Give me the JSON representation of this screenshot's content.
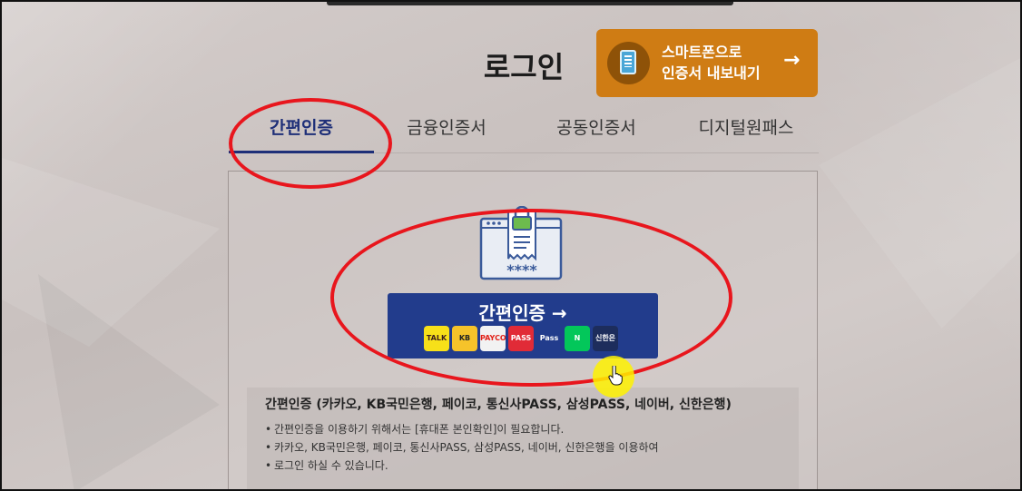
{
  "page": {
    "title": "로그인"
  },
  "export_button": {
    "line1": "스마트폰으로",
    "line2": "인증서 내보내기",
    "arrow": "→",
    "icon": "smartphone-icon"
  },
  "tabs": [
    {
      "label": "간편인증",
      "active": true
    },
    {
      "label": "금융인증서",
      "active": false
    },
    {
      "label": "공동인증서",
      "active": false
    },
    {
      "label": "디지털원패스",
      "active": false
    }
  ],
  "simple_auth": {
    "illustration": {
      "icon": "lock-certificate-icon",
      "password_mask": "****"
    },
    "button_label": "간편인증 →",
    "providers": [
      {
        "name": "kakaotalk-logo",
        "text": "TALK",
        "bg": "#f7e019",
        "fg": "#3a1d1d"
      },
      {
        "name": "kb-logo",
        "text": "KB",
        "bg": "#f6c32a",
        "fg": "#222222"
      },
      {
        "name": "payco-logo",
        "text": "PAYCO",
        "bg": "#f2f2f2",
        "fg": "#e2231a"
      },
      {
        "name": "pass-logo",
        "text": "PASS",
        "bg": "#e12b37",
        "fg": "#ffffff"
      },
      {
        "name": "samsung-pass-logo",
        "text": "Pass",
        "bg": "#223c8c",
        "fg": "#ffffff"
      },
      {
        "name": "naver-logo",
        "text": "N",
        "bg": "#03c75a",
        "fg": "#ffffff"
      },
      {
        "name": "shinhan-logo",
        "text": "신한은행",
        "bg": "#1d2d5c",
        "fg": "#ffffff"
      }
    ]
  },
  "info": {
    "heading": "간편인증 (카카오, KB국민은행, 페이코, 통신사PASS, 삼성PASS, 네이버, 신한은행)",
    "bullets": [
      "간편인증을 이용하기 위해서는 [휴대폰 본인확인]이 필요합니다.",
      "카카오, KB국민은행, 페이코, 통신사PASS, 삼성PASS, 네이버, 신한은행을 이용하여",
      "로그인 하실 수 있습니다."
    ]
  },
  "colors": {
    "accent_orange": "#cf7c14",
    "primary_navy": "#223c8c",
    "annotation_red": "#e8161d",
    "cursor_highlight": "#fff200"
  }
}
